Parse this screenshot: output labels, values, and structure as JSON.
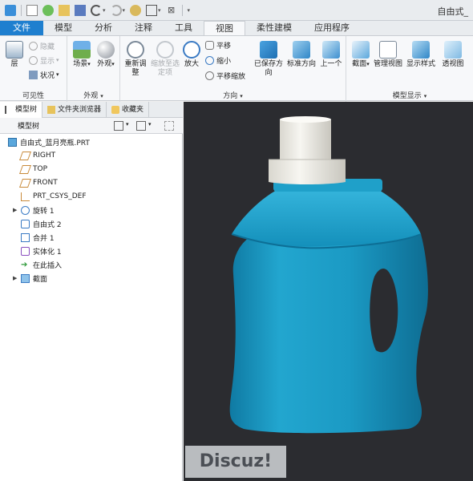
{
  "window": {
    "title": "自由式_"
  },
  "tabs": [
    {
      "label": "文件"
    },
    {
      "label": "模型"
    },
    {
      "label": "分析"
    },
    {
      "label": "注释"
    },
    {
      "label": "工具"
    },
    {
      "label": "视图"
    },
    {
      "label": "柔性建模"
    },
    {
      "label": "应用程序"
    }
  ],
  "ribbon": {
    "visibility": {
      "layer": "层",
      "hide": "隐藏",
      "show": "显示",
      "status": "状况",
      "label": "可见性"
    },
    "appearance": {
      "scene": "场景",
      "appearance": "外观",
      "label": "外观"
    },
    "orientation": {
      "refit": "重新调整",
      "zoom_to_selected": "缩放至选定项",
      "zoom_in": "放大",
      "pan": "平移",
      "zoom_out": "缩小",
      "pan_zoom": "平移缩放",
      "saved_orientations": "已保存方向",
      "standard_orientation": "标准方向",
      "previous": "上一个",
      "label": "方向"
    },
    "model_display": {
      "section": "截面",
      "manage_views": "管理视图",
      "display_style": "显示样式",
      "perspective": "透视图",
      "label": "模型显示"
    }
  },
  "panel_tabs": [
    {
      "label": "模型树"
    },
    {
      "label": "文件夹浏览器"
    },
    {
      "label": "收藏夹"
    }
  ],
  "tree": {
    "header": "模型树",
    "root": "自由式_蓝月亮瓶.PRT",
    "nodes": [
      {
        "label": "RIGHT"
      },
      {
        "label": "TOP"
      },
      {
        "label": "FRONT"
      },
      {
        "label": "PRT_CSYS_DEF"
      },
      {
        "label": "旋转 1"
      },
      {
        "label": "自由式 2"
      },
      {
        "label": "合并 1"
      },
      {
        "label": "实体化 1"
      },
      {
        "label": "在此插入"
      },
      {
        "label": "截面"
      }
    ]
  },
  "watermark": "Discuz!",
  "colors": {
    "accent": "#1f7fcf",
    "bottle": "#1f9bc4",
    "cap": "#f2f0e8",
    "viewport": "#2b2c30"
  }
}
